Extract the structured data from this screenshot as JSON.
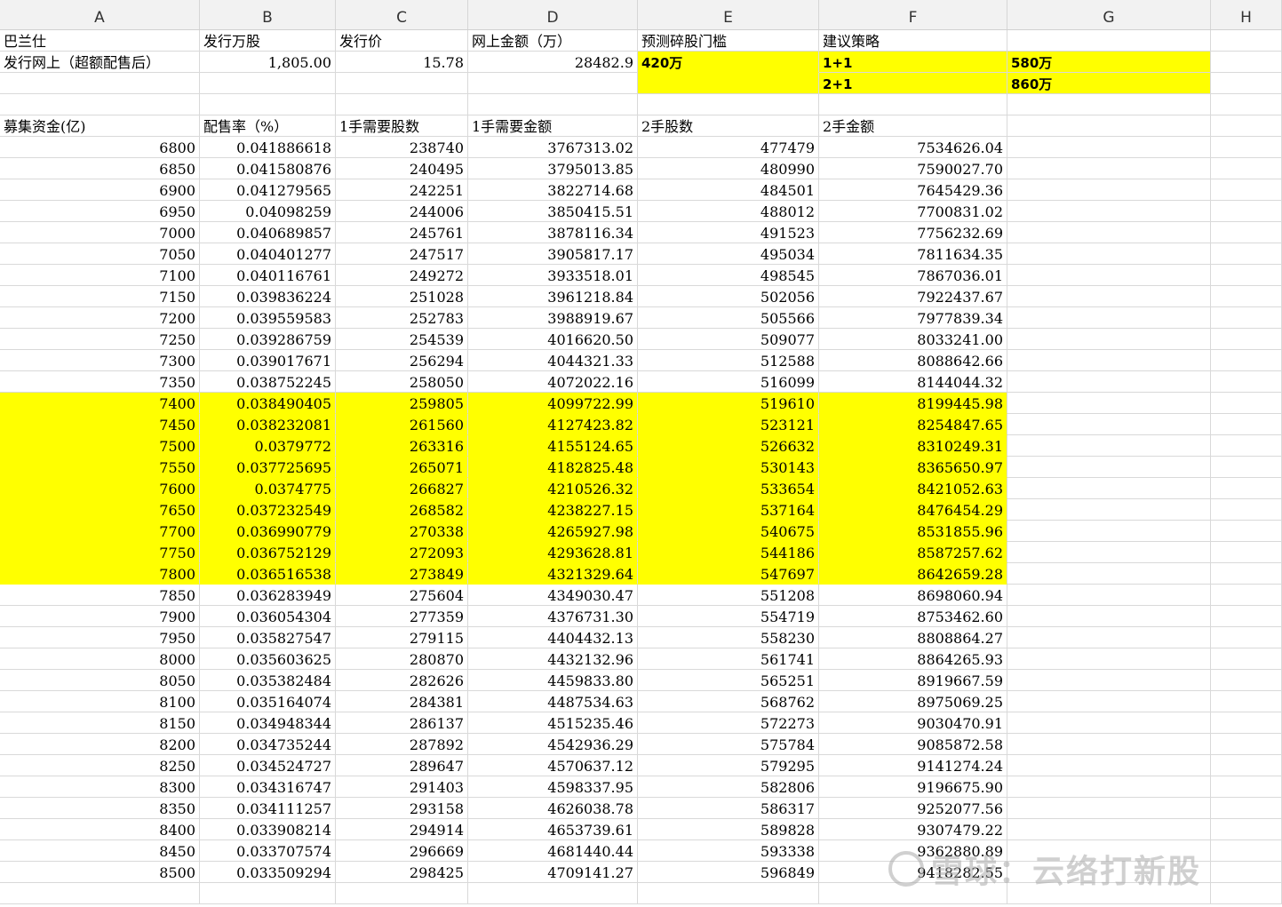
{
  "columns": [
    "A",
    "B",
    "C",
    "D",
    "E",
    "F",
    "G",
    "H"
  ],
  "row1": {
    "a": "巴兰仕",
    "b": "发行万股",
    "c": "发行价",
    "d": "网上金额（万）",
    "e": "预测碎股门槛",
    "f": "建议策略"
  },
  "row2": {
    "a": "发行网上（超额配售后）",
    "b": "1,805.00",
    "c": "15.78",
    "d": "28482.9",
    "e": "420万",
    "f": "1+1",
    "g": "580万"
  },
  "row3": {
    "f": "2+1",
    "g": "860万"
  },
  "row5": {
    "a": "募集资金(亿)",
    "b": "配售率（%）",
    "c": "1手需要股数",
    "d": "1手需要金额",
    "e": "2手股数",
    "f": "2手金额"
  },
  "data_rows": [
    {
      "a": "6800",
      "b": "0.041886618",
      "c": "238740",
      "d": "3767313.02",
      "e": "477479",
      "f": "7534626.04",
      "hl": false
    },
    {
      "a": "6850",
      "b": "0.041580876",
      "c": "240495",
      "d": "3795013.85",
      "e": "480990",
      "f": "7590027.70",
      "hl": false
    },
    {
      "a": "6900",
      "b": "0.041279565",
      "c": "242251",
      "d": "3822714.68",
      "e": "484501",
      "f": "7645429.36",
      "hl": false
    },
    {
      "a": "6950",
      "b": "0.04098259",
      "c": "244006",
      "d": "3850415.51",
      "e": "488012",
      "f": "7700831.02",
      "hl": false
    },
    {
      "a": "7000",
      "b": "0.040689857",
      "c": "245761",
      "d": "3878116.34",
      "e": "491523",
      "f": "7756232.69",
      "hl": false
    },
    {
      "a": "7050",
      "b": "0.040401277",
      "c": "247517",
      "d": "3905817.17",
      "e": "495034",
      "f": "7811634.35",
      "hl": false
    },
    {
      "a": "7100",
      "b": "0.040116761",
      "c": "249272",
      "d": "3933518.01",
      "e": "498545",
      "f": "7867036.01",
      "hl": false
    },
    {
      "a": "7150",
      "b": "0.039836224",
      "c": "251028",
      "d": "3961218.84",
      "e": "502056",
      "f": "7922437.67",
      "hl": false
    },
    {
      "a": "7200",
      "b": "0.039559583",
      "c": "252783",
      "d": "3988919.67",
      "e": "505566",
      "f": "7977839.34",
      "hl": false
    },
    {
      "a": "7250",
      "b": "0.039286759",
      "c": "254539",
      "d": "4016620.50",
      "e": "509077",
      "f": "8033241.00",
      "hl": false
    },
    {
      "a": "7300",
      "b": "0.039017671",
      "c": "256294",
      "d": "4044321.33",
      "e": "512588",
      "f": "8088642.66",
      "hl": false
    },
    {
      "a": "7350",
      "b": "0.038752245",
      "c": "258050",
      "d": "4072022.16",
      "e": "516099",
      "f": "8144044.32",
      "hl": false
    },
    {
      "a": "7400",
      "b": "0.038490405",
      "c": "259805",
      "d": "4099722.99",
      "e": "519610",
      "f": "8199445.98",
      "hl": true
    },
    {
      "a": "7450",
      "b": "0.038232081",
      "c": "261560",
      "d": "4127423.82",
      "e": "523121",
      "f": "8254847.65",
      "hl": true
    },
    {
      "a": "7500",
      "b": "0.0379772",
      "c": "263316",
      "d": "4155124.65",
      "e": "526632",
      "f": "8310249.31",
      "hl": true
    },
    {
      "a": "7550",
      "b": "0.037725695",
      "c": "265071",
      "d": "4182825.48",
      "e": "530143",
      "f": "8365650.97",
      "hl": true
    },
    {
      "a": "7600",
      "b": "0.0374775",
      "c": "266827",
      "d": "4210526.32",
      "e": "533654",
      "f": "8421052.63",
      "hl": true
    },
    {
      "a": "7650",
      "b": "0.037232549",
      "c": "268582",
      "d": "4238227.15",
      "e": "537164",
      "f": "8476454.29",
      "hl": true
    },
    {
      "a": "7700",
      "b": "0.036990779",
      "c": "270338",
      "d": "4265927.98",
      "e": "540675",
      "f": "8531855.96",
      "hl": true
    },
    {
      "a": "7750",
      "b": "0.036752129",
      "c": "272093",
      "d": "4293628.81",
      "e": "544186",
      "f": "8587257.62",
      "hl": true
    },
    {
      "a": "7800",
      "b": "0.036516538",
      "c": "273849",
      "d": "4321329.64",
      "e": "547697",
      "f": "8642659.28",
      "hl": true
    },
    {
      "a": "7850",
      "b": "0.036283949",
      "c": "275604",
      "d": "4349030.47",
      "e": "551208",
      "f": "8698060.94",
      "hl": false
    },
    {
      "a": "7900",
      "b": "0.036054304",
      "c": "277359",
      "d": "4376731.30",
      "e": "554719",
      "f": "8753462.60",
      "hl": false
    },
    {
      "a": "7950",
      "b": "0.035827547",
      "c": "279115",
      "d": "4404432.13",
      "e": "558230",
      "f": "8808864.27",
      "hl": false
    },
    {
      "a": "8000",
      "b": "0.035603625",
      "c": "280870",
      "d": "4432132.96",
      "e": "561741",
      "f": "8864265.93",
      "hl": false
    },
    {
      "a": "8050",
      "b": "0.035382484",
      "c": "282626",
      "d": "4459833.80",
      "e": "565251",
      "f": "8919667.59",
      "hl": false
    },
    {
      "a": "8100",
      "b": "0.035164074",
      "c": "284381",
      "d": "4487534.63",
      "e": "568762",
      "f": "8975069.25",
      "hl": false
    },
    {
      "a": "8150",
      "b": "0.034948344",
      "c": "286137",
      "d": "4515235.46",
      "e": "572273",
      "f": "9030470.91",
      "hl": false
    },
    {
      "a": "8200",
      "b": "0.034735244",
      "c": "287892",
      "d": "4542936.29",
      "e": "575784",
      "f": "9085872.58",
      "hl": false
    },
    {
      "a": "8250",
      "b": "0.034524727",
      "c": "289647",
      "d": "4570637.12",
      "e": "579295",
      "f": "9141274.24",
      "hl": false
    },
    {
      "a": "8300",
      "b": "0.034316747",
      "c": "291403",
      "d": "4598337.95",
      "e": "582806",
      "f": "9196675.90",
      "hl": false
    },
    {
      "a": "8350",
      "b": "0.034111257",
      "c": "293158",
      "d": "4626038.78",
      "e": "586317",
      "f": "9252077.56",
      "hl": false
    },
    {
      "a": "8400",
      "b": "0.033908214",
      "c": "294914",
      "d": "4653739.61",
      "e": "589828",
      "f": "9307479.22",
      "hl": false
    },
    {
      "a": "8450",
      "b": "0.033707574",
      "c": "296669",
      "d": "4681440.44",
      "e": "593338",
      "f": "9362880.89",
      "hl": false
    },
    {
      "a": "8500",
      "b": "0.033509294",
      "c": "298425",
      "d": "4709141.27",
      "e": "596849",
      "f": "9418282.55",
      "hl": false
    }
  ],
  "watermark": "雪球：云络打新股",
  "colors": {
    "highlight": "#ffff00",
    "header_bg": "#f2f2f2",
    "gridline": "#d9d9d9"
  }
}
